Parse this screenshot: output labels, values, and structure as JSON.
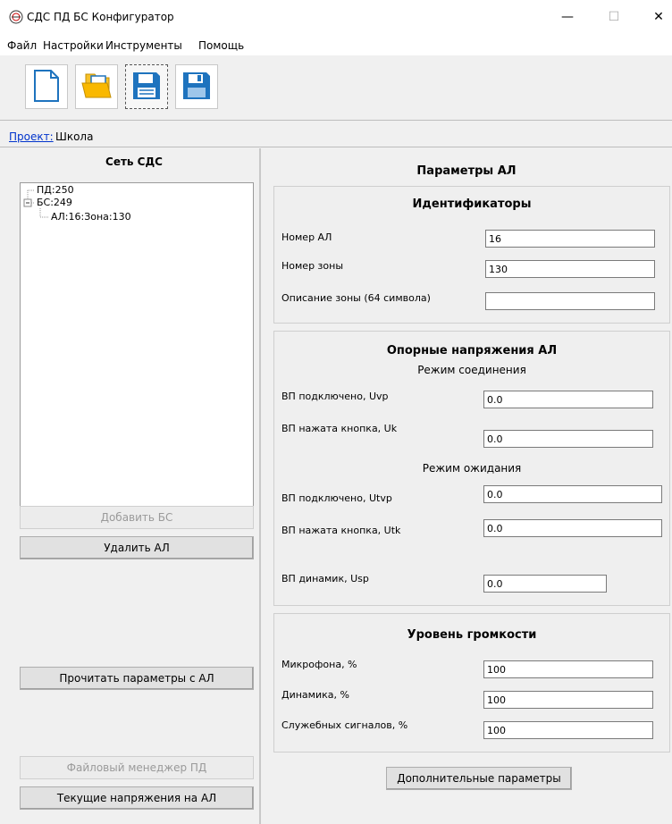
{
  "window": {
    "title": "СДС ПД БС Конфигуратор",
    "minimize_glyph": "—",
    "maximize_glyph": "☐",
    "close_glyph": "✕"
  },
  "menu": {
    "items": [
      "Файл",
      "Настройки",
      "Инструменты",
      "Помощь"
    ]
  },
  "toolbar": {
    "buttons": [
      {
        "icon": "new-file-icon"
      },
      {
        "icon": "open-folder-icon"
      },
      {
        "icon": "save-icon"
      },
      {
        "icon": "save-as-icon"
      }
    ]
  },
  "project": {
    "link_label": "Проект:",
    "name": "Школа"
  },
  "left": {
    "tree_title": "Сеть СДС",
    "tree": [
      "ПД:250",
      "БС:249",
      "АЛ:16:Зона:130"
    ],
    "buttons": {
      "add_bs": "Добавить БС",
      "delete_al": "Удалить АЛ",
      "read_params": "Прочитать параметры с АЛ",
      "file_manager": "Файловый менеджер ПД",
      "current_voltages": "Текущие напряжения на АЛ"
    }
  },
  "right": {
    "title": "Параметры АЛ",
    "identifiers": {
      "title": "Идентификаторы",
      "al_number_label": "Номер АЛ",
      "al_number_value": "16",
      "zone_number_label": "Номер зоны",
      "zone_number_value": "130",
      "zone_desc_label": "Описание зоны (64 символа)",
      "zone_desc_value": ""
    },
    "voltages": {
      "title": "Опорные напряжения  АЛ",
      "connection_mode": "Режим соединения",
      "uvp_label": "ВП подключено, Uvp",
      "uvp_value": "0.0",
      "uk_label": "ВП нажата кнопка, Uk",
      "uk_value": "0.0",
      "standby_mode": "Режим ожидания",
      "utvp_label": "ВП подключено, Utvp",
      "utvp_value": "0.0",
      "utk_label": "ВП нажата кнопка, Utk",
      "utk_value": "0.0",
      "usp_label": "ВП динамик, Usp",
      "usp_value": "0.0"
    },
    "volume": {
      "title": "Уровень громкости",
      "mic_label": "Микрофона, %",
      "mic_value": "100",
      "speaker_label": "Динамика, %",
      "speaker_value": "100",
      "service_label": "Служебных сигналов, %",
      "service_value": "100"
    },
    "extra_button": "Дополнительные параметры"
  }
}
